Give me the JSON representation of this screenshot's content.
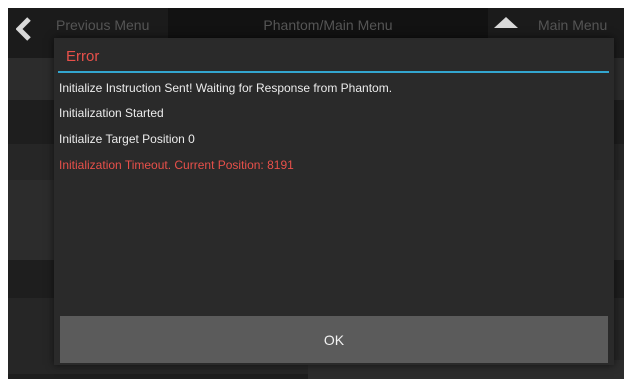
{
  "app_header": {
    "left_label": "Previous Menu",
    "center_title": "Phantom/Main Menu",
    "right_label": "Main Menu",
    "back_icon": "chevron-left-icon",
    "home_icon": "home-icon"
  },
  "dialog": {
    "title": "Error",
    "title_color": "#e8504a",
    "accent_color": "#33a6cf",
    "messages": [
      {
        "text": "Initialize Instruction Sent! Waiting for Response from Phantom.",
        "kind": "info"
      },
      {
        "text": "Initialization Started",
        "kind": "info"
      },
      {
        "text": "Initialize Target Position 0",
        "kind": "info"
      },
      {
        "text": "Initialization Timeout. Current Position: 8191",
        "kind": "error"
      }
    ],
    "ok_label": "OK"
  }
}
